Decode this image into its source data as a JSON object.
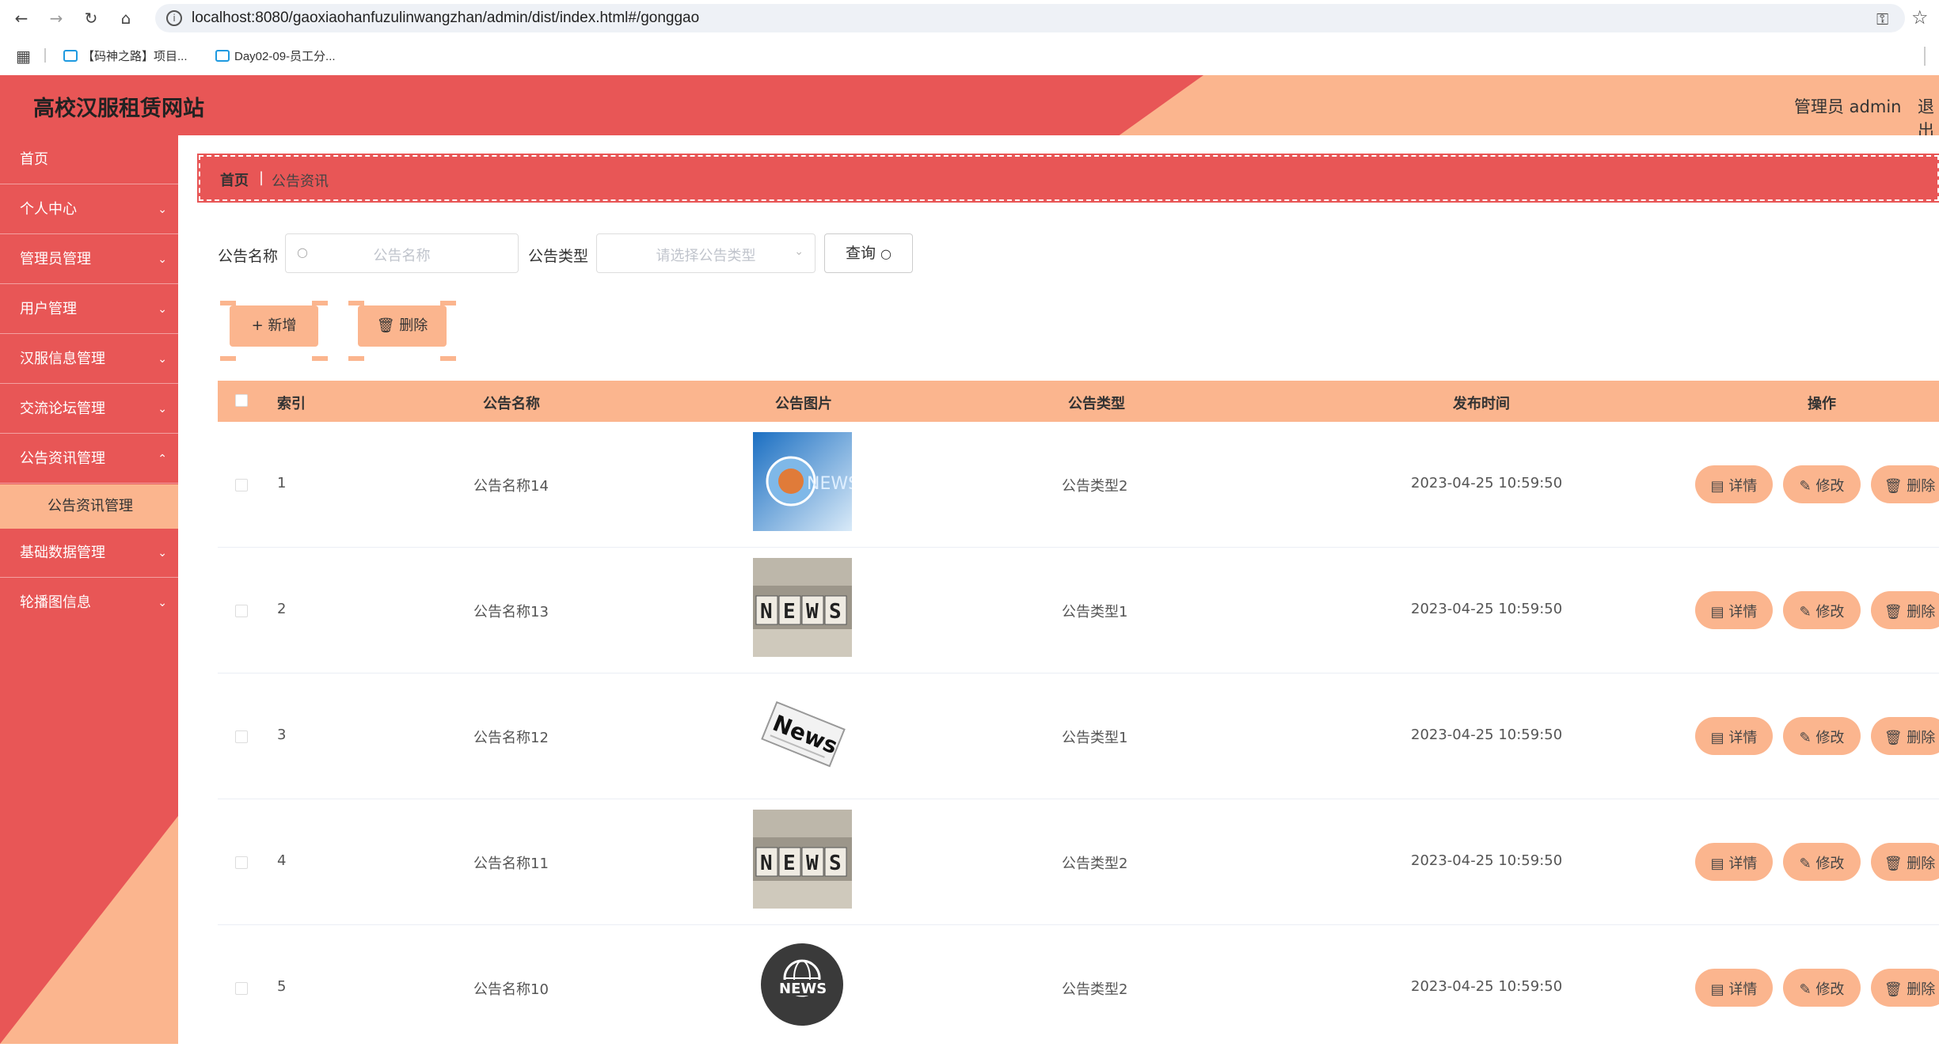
{
  "browser": {
    "url": "localhost:8080/gaoxiaohanfuzulinwangzhan/admin/dist/index.html#/gonggao",
    "bookmarks": [
      "【码神之路】项目...",
      "Day02-09-员工分..."
    ]
  },
  "header": {
    "title": "高校汉服租赁网站",
    "admin": "管理员 admin",
    "logout": "退出"
  },
  "sidebar": {
    "items": [
      {
        "label": "首页",
        "expandable": false
      },
      {
        "label": "个人中心",
        "expandable": true
      },
      {
        "label": "管理员管理",
        "expandable": true
      },
      {
        "label": "用户管理",
        "expandable": true
      },
      {
        "label": "汉服信息管理",
        "expandable": true
      },
      {
        "label": "交流论坛管理",
        "expandable": true
      },
      {
        "label": "公告资讯管理",
        "expandable": true
      },
      {
        "label": "公告资讯管理",
        "sub": true
      },
      {
        "label": "基础数据管理",
        "expandable": true
      },
      {
        "label": "轮播图信息",
        "expandable": true
      }
    ]
  },
  "breadcrumb": {
    "home": "首页",
    "current": "公告资讯"
  },
  "filters": {
    "name_label": "公告名称",
    "name_placeholder": "公告名称",
    "type_label": "公告类型",
    "type_placeholder": "请选择公告类型",
    "query_label": "查询"
  },
  "actions": {
    "add": "新增",
    "delete": "删除"
  },
  "table": {
    "headers": [
      "索引",
      "公告名称",
      "公告图片",
      "公告类型",
      "发布时间",
      "操作"
    ],
    "rows": [
      {
        "index": "1",
        "name": "公告名称14",
        "image": "news-globe",
        "type": "公告类型2",
        "time": "2023-04-25 10:59:50"
      },
      {
        "index": "2",
        "name": "公告名称13",
        "image": "news-dice",
        "type": "公告类型1",
        "time": "2023-04-25 10:59:50"
      },
      {
        "index": "3",
        "name": "公告名称12",
        "image": "news-paper",
        "type": "公告类型1",
        "time": "2023-04-25 10:59:50"
      },
      {
        "index": "4",
        "name": "公告名称11",
        "image": "news-dice",
        "type": "公告类型2",
        "time": "2023-04-25 10:59:50"
      },
      {
        "index": "5",
        "name": "公告名称10",
        "image": "news-circle",
        "type": "公告类型2",
        "time": "2023-04-25 10:59:50"
      }
    ],
    "row_actions": {
      "detail": "详情",
      "edit": "修改",
      "delete": "删除"
    }
  },
  "colors": {
    "primary": "#e85656",
    "accent": "#fbb58e"
  }
}
